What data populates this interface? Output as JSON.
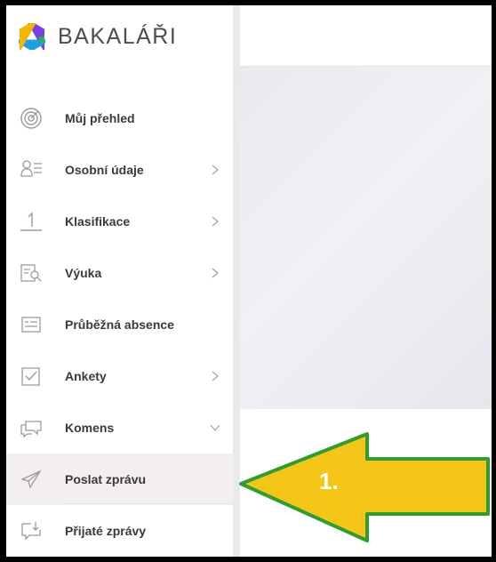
{
  "brand": {
    "name": "BAKALÁŘI"
  },
  "sidebar": {
    "items": [
      {
        "label": "Můj přehled",
        "icon": "target-icon",
        "has_chevron": false
      },
      {
        "label": "Osobní údaje",
        "icon": "person-list-icon",
        "has_chevron": true
      },
      {
        "label": "Klasifikace",
        "icon": "grade-one-icon",
        "has_chevron": true
      },
      {
        "label": "Výuka",
        "icon": "book-search-icon",
        "has_chevron": true
      },
      {
        "label": "Průběžná absence",
        "icon": "absence-card-icon",
        "has_chevron": false
      },
      {
        "label": "Ankety",
        "icon": "checkbox-icon",
        "has_chevron": true
      },
      {
        "label": "Komens",
        "icon": "chat-bubbles-icon",
        "has_chevron": true,
        "expanded": true
      },
      {
        "label": "Poslat zprávu",
        "icon": "paper-plane-icon",
        "has_chevron": false,
        "active": true
      },
      {
        "label": "Přijaté zprávy",
        "icon": "inbox-download-icon",
        "has_chevron": false
      }
    ]
  },
  "annotation": {
    "step": "1.",
    "arrow_color": "#f5c518",
    "arrow_border": "#2e9e2e"
  },
  "colors": {
    "icon": "#9a9a9a",
    "text": "#3a3a3a",
    "active_bg": "#f3eef0"
  }
}
